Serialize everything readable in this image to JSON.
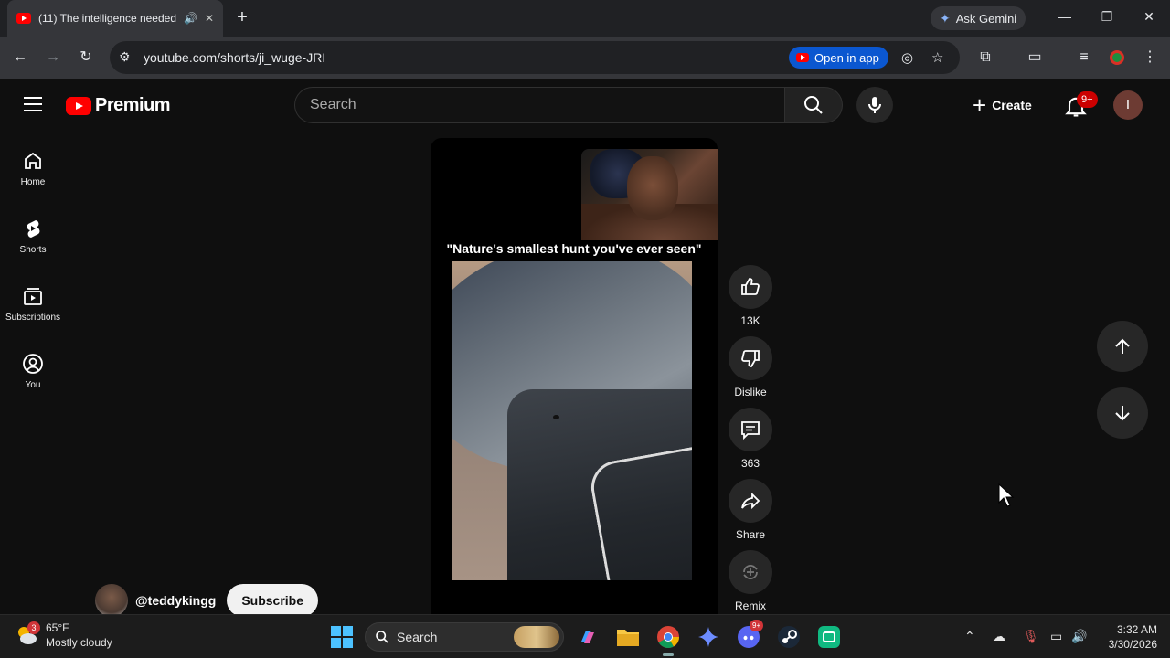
{
  "browser": {
    "tab_title": "(11) The intelligence needed",
    "new_tab": "+",
    "ask_gemini": "Ask Gemini",
    "url": "youtube.com/shorts/ji_wuge-JRI",
    "open_in_app": "Open in app"
  },
  "youtube": {
    "logo_text": "Premium",
    "search_placeholder": "Search",
    "create_label": "Create",
    "notification_count": "9+",
    "account_initial": "I",
    "nav": [
      {
        "label": "Home"
      },
      {
        "label": "Shorts"
      },
      {
        "label": "Subscriptions"
      },
      {
        "label": "You"
      }
    ]
  },
  "short": {
    "caption": "\"Nature's smallest hunt you've ever seen\"",
    "channel": "@teddykingg",
    "subscribe": "Subscribe",
    "likes": "13K",
    "dislike_label": "Dislike",
    "comments": "363",
    "share_label": "Share",
    "remix_label": "Remix"
  },
  "taskbar": {
    "weather_badge": "3",
    "temperature": "65°F",
    "condition": "Mostly cloudy",
    "search_label": "Search",
    "discord_badge": "9+",
    "time": "3:32 AM",
    "date": "3/30/2026"
  }
}
